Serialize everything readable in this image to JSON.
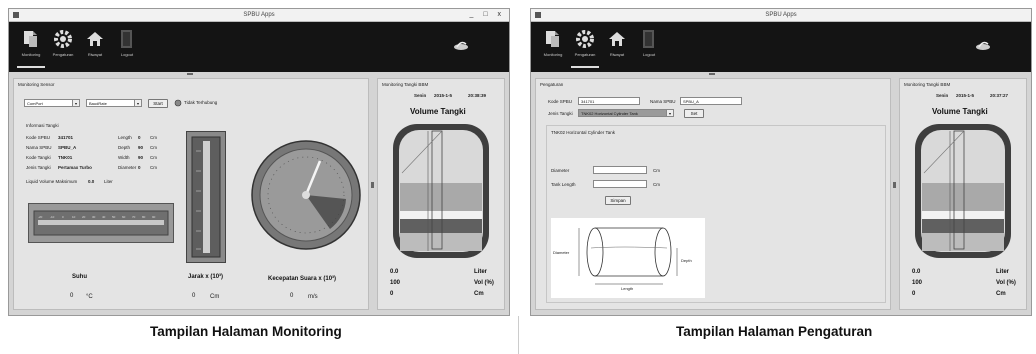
{
  "captions": {
    "left": "Tampilan Halaman Monitoring",
    "right": "Tampilan Halaman Pengaturan"
  },
  "window": {
    "title": "SPBU Apps",
    "controls": "_ □ x"
  },
  "toolbar": {
    "items": [
      {
        "label": "Monitoring",
        "icon": "monitoring-icon"
      },
      {
        "label": "Pengaturan",
        "icon": "gear-icon"
      },
      {
        "label": "Riwayat",
        "icon": "home-icon"
      },
      {
        "label": "Logout",
        "icon": "door-icon"
      }
    ]
  },
  "monitoring": {
    "panel_title": "Monitoring Sensor",
    "combo_port": "ComPort",
    "combo_baud": "BaudRate",
    "connect_button": "Start",
    "status_text": "Tidak Terhubung",
    "info_title": "Informasi Tangki",
    "info_rows": [
      {
        "label": "Kode SPBU",
        "value": "341701",
        "dim_label": "Length",
        "dim_value": "0",
        "unit": "Cm"
      },
      {
        "label": "Nama SPBU",
        "value": "SPBU_A",
        "dim_label": "Depth",
        "dim_value": "90",
        "unit": "Cm"
      },
      {
        "label": "Kode Tangki",
        "value": "TNK01",
        "dim_label": "Width",
        "dim_value": "90",
        "unit": "Cm"
      },
      {
        "label": "Jenis Tangki",
        "value": "Pertamax Turbo",
        "dim_label": "Diameter",
        "dim_value": "0",
        "unit": "Cm"
      }
    ],
    "liquid_label": "Liquid Volume Maksimum",
    "liquid_value": "0.0",
    "liquid_unit": "Liter",
    "suhu_title": "Suhu",
    "suhu_value": "0",
    "suhu_unit": "°C",
    "jarak_title": "Jarak x (10³)",
    "jarak_value": "0",
    "jarak_unit": "Cm",
    "kec_title": "Kecepatan Suara x (10³)",
    "kec_value": "0",
    "kec_unit": "m/s"
  },
  "pengaturan": {
    "panel_title": "Pengaturan",
    "kode_label": "Kode SPBU",
    "kode_value": "341701",
    "nama_label": "Nama SPBU",
    "nama_value": "SPBU_A",
    "jenis_label": "Jenis Tangki",
    "jenis_value": "TNK02 Horizontal Cylinder Tank",
    "set_button": "Set",
    "tank_type_text": "TNK02 Horizontal Cylinder Tank",
    "diameter_label": "Diameter",
    "diameter_unit": "Cm",
    "length_label": "Tank Length",
    "length_unit": "Cm",
    "simpan_button": "Simpan",
    "diagram_diameter": "Diameter",
    "diagram_depth": "Depth",
    "diagram_length": "Length"
  },
  "tank_panel": {
    "title": "Monitoring Tangki BBM",
    "day_label": "Senin",
    "date_left": "2015-1-5",
    "time_left": "20:38:39",
    "date_right": "2015-1-5",
    "time_right": "20:37:27",
    "volume_title": "Volume Tangki",
    "rows": [
      {
        "value": "0.0",
        "unit": "Liter"
      },
      {
        "value": "100",
        "unit": "Vol (%)"
      },
      {
        "value": "0",
        "unit": "Cm"
      }
    ]
  }
}
